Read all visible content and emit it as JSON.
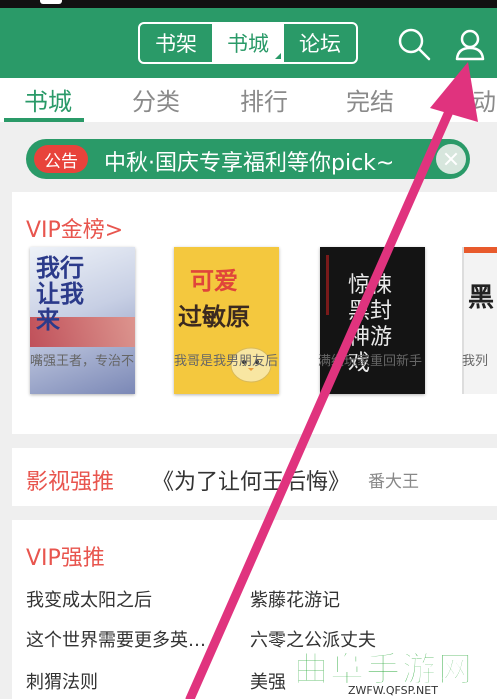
{
  "header": {
    "segments": [
      {
        "label": "书架"
      },
      {
        "label": "书城"
      },
      {
        "label": "论坛"
      }
    ]
  },
  "tabs": [
    {
      "label": "书城"
    },
    {
      "label": "分类"
    },
    {
      "label": "排行"
    },
    {
      "label": "完结"
    },
    {
      "label": "活动"
    }
  ],
  "notice": {
    "badge": "公告",
    "text": "中秋·国庆专享福利等你pick~"
  },
  "vip_gold": {
    "title": "VIP金榜>",
    "books": [
      {
        "name": "嘴强王者，专治不",
        "cover_text": "我行让我来"
      },
      {
        "name": "我哥是我男朋友后",
        "cover_text_1": "可爱",
        "cover_text_2": "过敏原"
      },
      {
        "name": "满级玩家重回新手",
        "cover_text": "惊悚黑封神游戏"
      },
      {
        "name": "我列",
        "cover_text": "黑"
      }
    ]
  },
  "film_push": {
    "label": "影视强推",
    "book": "《为了让何王后悔》",
    "author": "番大王"
  },
  "vip_push": {
    "title": "VIP强推",
    "items": [
      "我变成太阳之后",
      "紫藤花游记",
      "这个世界需要更多英…",
      "六零之公派丈夫",
      "刺猬法则",
      "美强"
    ]
  },
  "watermark": {
    "text": "曲阜手游网",
    "url": "ZWFW.QFSP.NET"
  },
  "colors": {
    "brand_green": "#2a9a68",
    "accent_red": "#e8554e",
    "arrow_pink": "#e0337e"
  }
}
